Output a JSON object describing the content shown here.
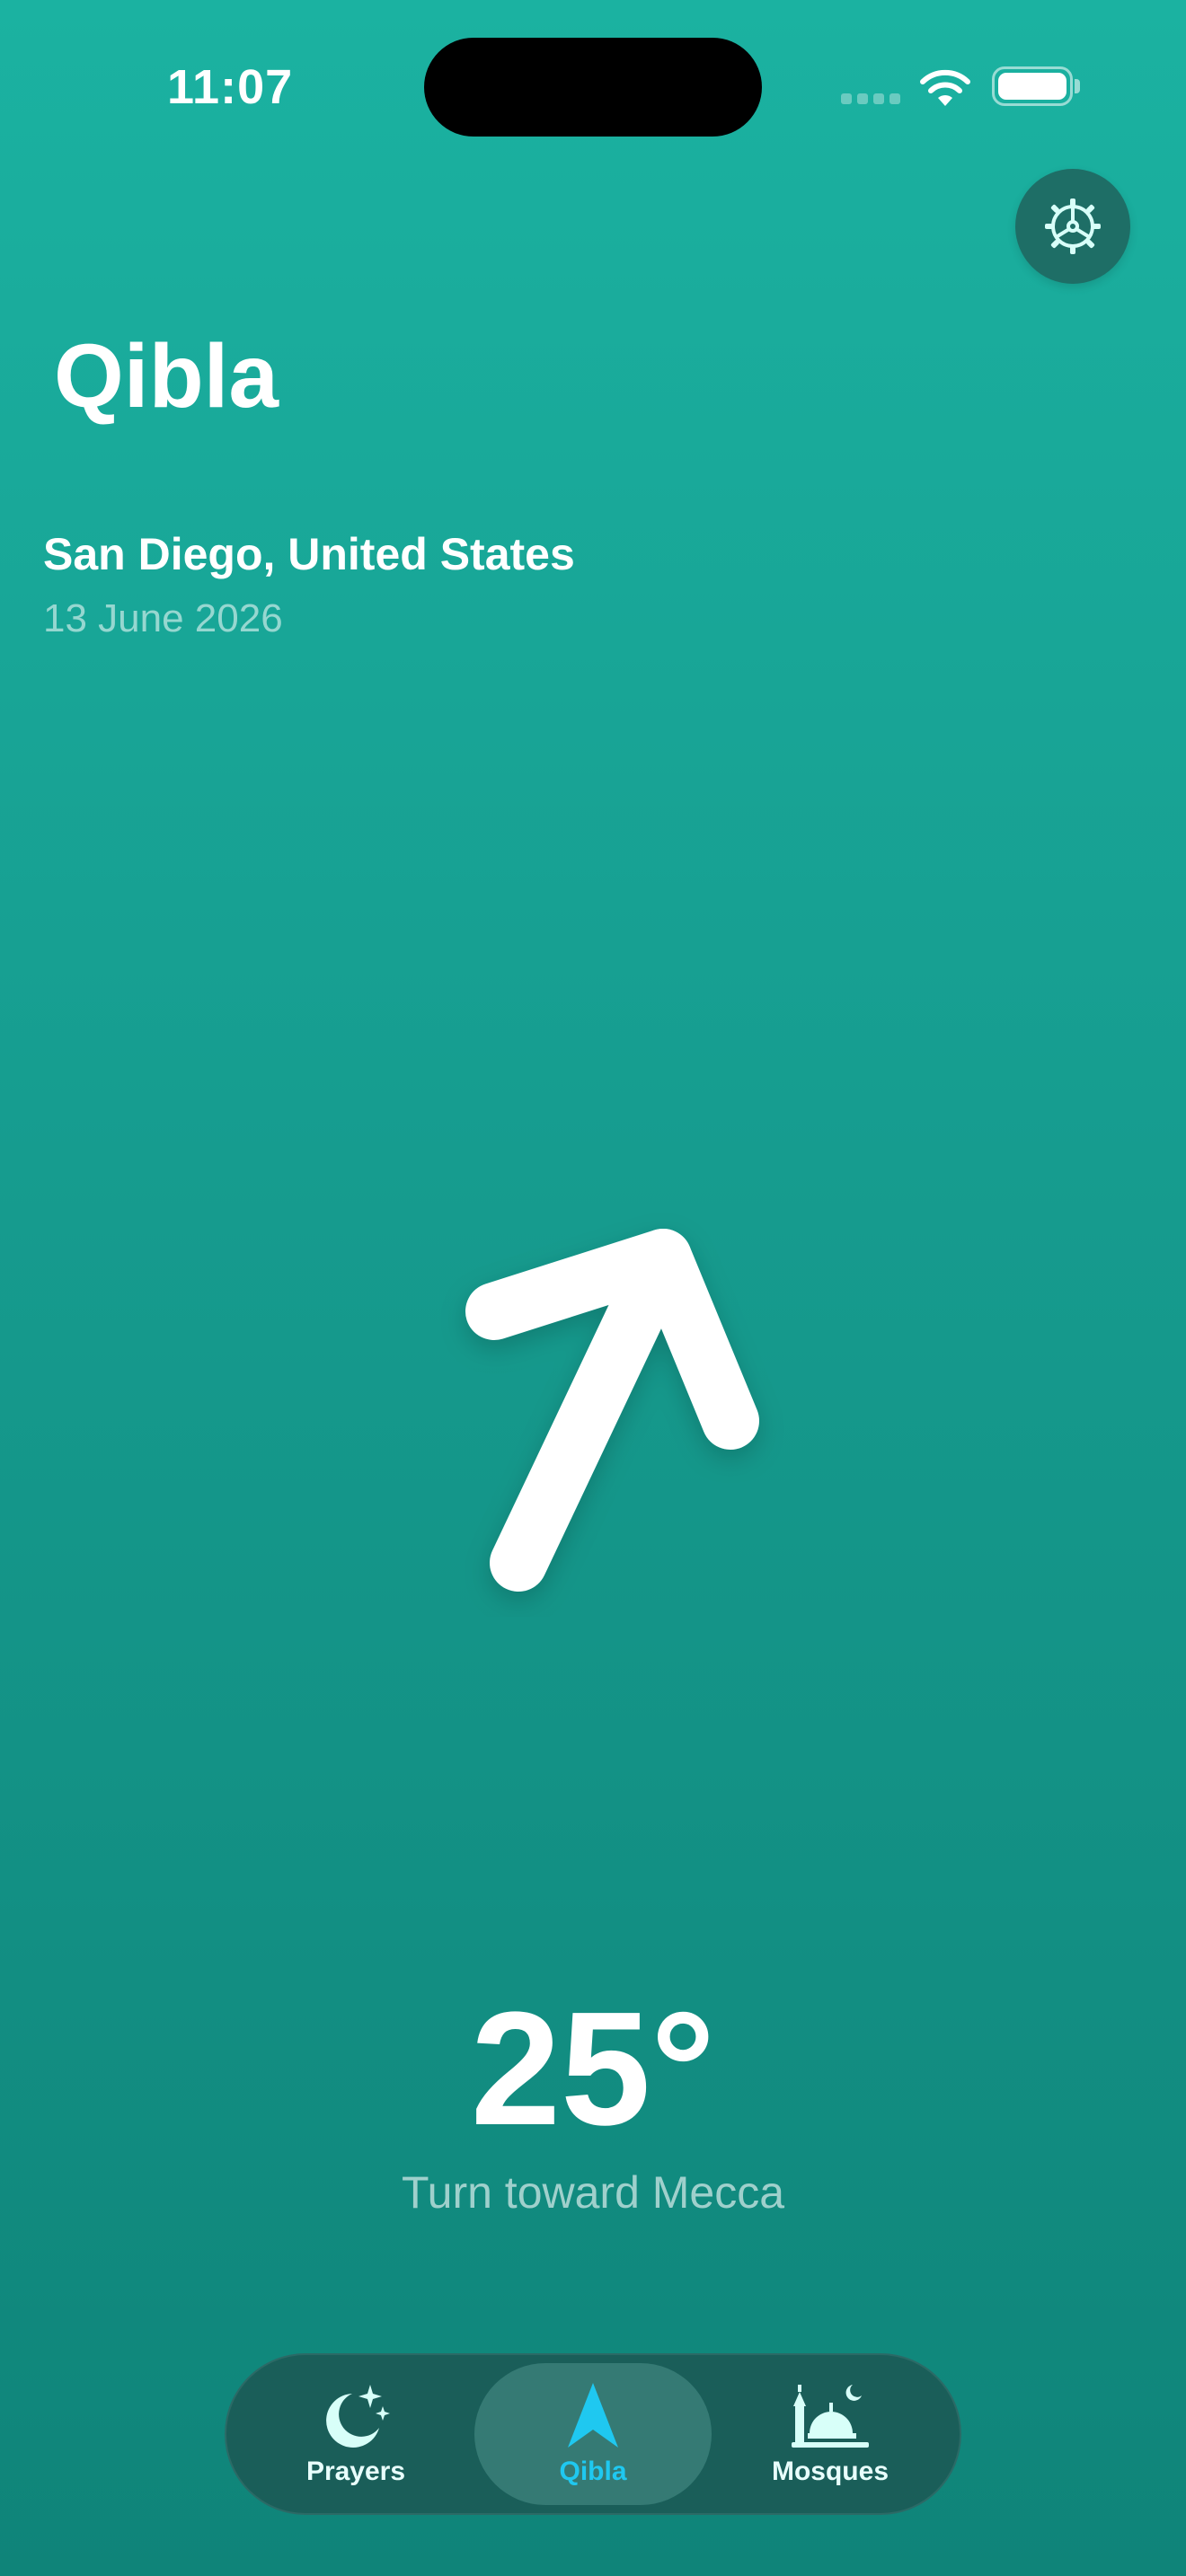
{
  "status_bar": {
    "time": "11:07"
  },
  "header": {
    "title": "Qibla",
    "location": "San Diego, United States",
    "date": "13 June 2026"
  },
  "qibla": {
    "degrees": "25°",
    "hint": "Turn toward Mecca"
  },
  "tabs": [
    {
      "label": "Prayers",
      "icon": "moon-stars-icon",
      "active": false
    },
    {
      "label": "Qibla",
      "icon": "location-arrow-icon",
      "active": true
    },
    {
      "label": "Mosques",
      "icon": "mosque-icon",
      "active": false
    }
  ],
  "colors": {
    "background_top": "#1BB2A1",
    "background_bottom": "#0F8479",
    "tab_bar": "#1A5E59",
    "active_accent": "#1FC8F0",
    "settings_button": "#1E6E66"
  }
}
